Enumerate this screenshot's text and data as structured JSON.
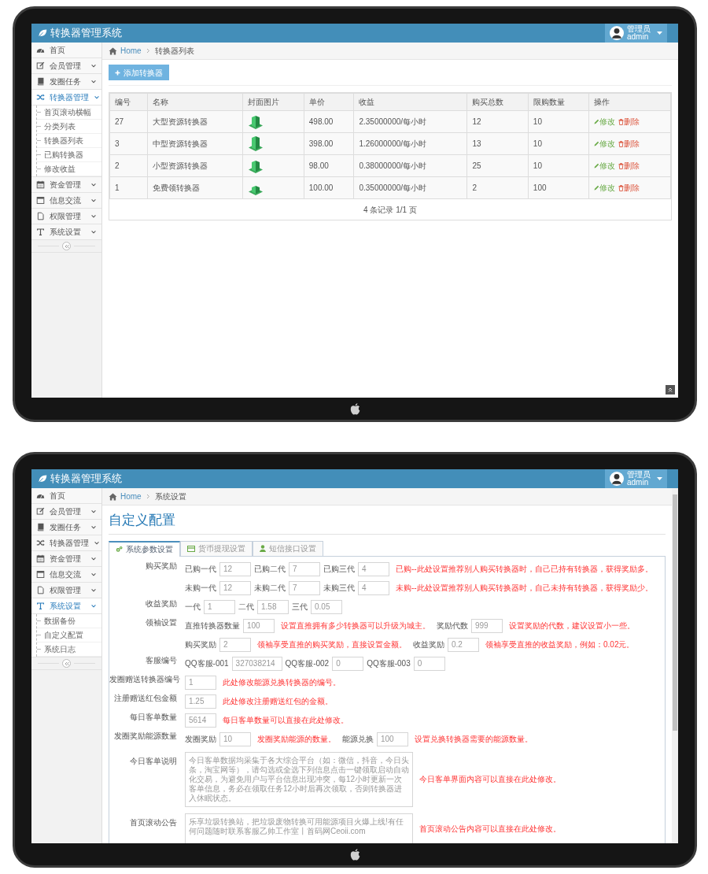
{
  "list_screen": {
    "header": {
      "title": "转换器管理系统",
      "user_role": "管理员",
      "user_name": "admin"
    },
    "sidebar": {
      "items": [
        {
          "label": "首页",
          "collapsible": false,
          "selected": false
        },
        {
          "label": "会员管理",
          "collapsible": true,
          "selected": false
        },
        {
          "label": "发圈任务",
          "collapsible": true,
          "selected": false
        },
        {
          "label": "转换器管理",
          "collapsible": true,
          "selected": true,
          "children": [
            {
              "label": "首页滚动横幅"
            },
            {
              "label": "分类列表"
            },
            {
              "label": "转换器列表"
            },
            {
              "label": "已购转换器"
            },
            {
              "label": "修改收益"
            }
          ]
        },
        {
          "label": "资金管理",
          "collapsible": true,
          "selected": false
        },
        {
          "label": "信息交流",
          "collapsible": true,
          "selected": false
        },
        {
          "label": "权限管理",
          "collapsible": true,
          "selected": false
        },
        {
          "label": "系统设置",
          "collapsible": true,
          "selected": false
        }
      ]
    },
    "breadcrumb": {
      "home": "Home",
      "current": "转换器列表"
    },
    "add_button": "添加转换器",
    "table": {
      "columns": [
        {
          "label": "编号",
          "kind": "text"
        },
        {
          "label": "名称",
          "kind": "text"
        },
        {
          "label": "封面图片",
          "kind": "image"
        },
        {
          "label": "单价",
          "kind": "text"
        },
        {
          "label": "收益",
          "kind": "text"
        },
        {
          "label": "购买总数",
          "kind": "text"
        },
        {
          "label": "限购数量",
          "kind": "text"
        },
        {
          "label": "操作",
          "kind": "actions"
        }
      ],
      "rows": [
        {
          "cells": [
            "27",
            "大型资源转换器",
            "",
            "498.00",
            "2.35000000/每小时",
            "12",
            "10"
          ],
          "actions": [
            {
              "kind": "edit",
              "label": "修改"
            },
            {
              "kind": "delete",
              "label": "删除"
            }
          ]
        },
        {
          "cells": [
            "3",
            "中型资源转换器",
            "",
            "398.00",
            "1.26000000/每小时",
            "13",
            "10"
          ],
          "actions": [
            {
              "kind": "edit",
              "label": "修改"
            },
            {
              "kind": "delete",
              "label": "删除"
            }
          ]
        },
        {
          "cells": [
            "2",
            "小型资源转换器",
            "",
            "98.00",
            "0.38000000/每小时",
            "25",
            "10"
          ],
          "actions": [
            {
              "kind": "edit",
              "label": "修改"
            },
            {
              "kind": "delete",
              "label": "删除"
            }
          ]
        },
        {
          "cells": [
            "1",
            "免费领转换器",
            "",
            "100.00",
            "0.35000000/每小时",
            "2",
            "100"
          ],
          "actions": [
            {
              "kind": "edit",
              "label": "修改"
            },
            {
              "kind": "delete",
              "label": "删除"
            }
          ]
        }
      ],
      "footer": "4 条记录 1/1 页"
    }
  },
  "config_screen": {
    "header": {
      "title": "转换器管理系统",
      "user_role": "管理员",
      "user_name": "admin"
    },
    "sidebar": {
      "items": [
        {
          "label": "首页",
          "collapsible": false,
          "selected": false
        },
        {
          "label": "会员管理",
          "collapsible": true,
          "selected": false
        },
        {
          "label": "发圈任务",
          "collapsible": true,
          "selected": false
        },
        {
          "label": "转换器管理",
          "collapsible": true,
          "selected": false
        },
        {
          "label": "资金管理",
          "collapsible": true,
          "selected": false
        },
        {
          "label": "信息交流",
          "collapsible": true,
          "selected": false
        },
        {
          "label": "权限管理",
          "collapsible": true,
          "selected": false
        },
        {
          "label": "系统设置",
          "collapsible": true,
          "selected": true,
          "children": [
            {
              "label": "数据备份"
            },
            {
              "label": "自定义配置"
            },
            {
              "label": "系统日志"
            }
          ]
        }
      ]
    },
    "breadcrumb": {
      "home": "Home",
      "current": "系统设置"
    },
    "page_title": "自定义配置",
    "tabs": [
      {
        "label": "系统参数设置",
        "selected": true
      },
      {
        "label": "货币提现设置",
        "selected": false
      },
      {
        "label": "短信接口设置",
        "selected": false
      }
    ],
    "form": {
      "rows": [
        {
          "kind": "inputs",
          "label": "购买奖励",
          "items": [
            {
              "prefix": "已购一代",
              "value": "12"
            },
            {
              "prefix": "已购二代",
              "value": "7"
            },
            {
              "prefix": "已购三代",
              "value": "4",
              "note": "已购--此处设置推荐别人购买转换器时，自己已持有转换器，获得奖励多。"
            }
          ]
        },
        {
          "kind": "inputs",
          "items": [
            {
              "prefix": "未购一代",
              "value": "12"
            },
            {
              "prefix": "未购二代",
              "value": "7"
            },
            {
              "prefix": "未购三代",
              "value": "4",
              "note": "未购--此处设置推荐别人购买转换器时，自己未持有转换器，获得奖励少。"
            }
          ]
        },
        {
          "kind": "inputs",
          "label": "收益奖励",
          "items": [
            {
              "prefix": "一代",
              "value": "1"
            },
            {
              "prefix": "二代",
              "value": "1.58"
            },
            {
              "prefix": "三代",
              "value": "0.05"
            }
          ]
        },
        {
          "kind": "inputs",
          "label": "领袖设置",
          "items": [
            {
              "prefix": "直推转换器数量",
              "value": "100",
              "note": "设置直推拥有多少转换器可以升级为城主。"
            },
            {
              "prefix": "奖励代数",
              "value": "999",
              "note": "设置奖励的代数，建议设置小一些。"
            }
          ]
        },
        {
          "kind": "inputs",
          "items": [
            {
              "prefix": "购买奖励",
              "value": "2",
              "note": "领袖享受直推的购买奖励，直接设置金额。"
            },
            {
              "prefix": "收益奖励",
              "value": "0.2",
              "note": "领袖享受直推的收益奖励，例如：0.02元。"
            }
          ]
        },
        {
          "kind": "inputs",
          "label": "客服编号",
          "items": [
            {
              "prefix": "QQ客服-001",
              "value": "327038214"
            },
            {
              "prefix": "QQ客服-002",
              "value": "0"
            },
            {
              "prefix": "QQ客服-003",
              "value": "0"
            }
          ]
        },
        {
          "kind": "inputs",
          "label": "发圈赠送转换器编号",
          "items": [
            {
              "value": "1",
              "note": "此处修改能源兑换转换器的编号。"
            }
          ]
        },
        {
          "kind": "inputs",
          "label": "注册赠送红包金额",
          "items": [
            {
              "value": "1.25",
              "note": "此处修改注册赠送红包的金额。"
            }
          ]
        },
        {
          "kind": "inputs",
          "label": "每日客单数量",
          "items": [
            {
              "value": "5614",
              "note": "每日客单数量可以直接在此处修改。"
            }
          ]
        },
        {
          "kind": "inputs",
          "label": "发圈奖励能源数量",
          "items": [
            {
              "prefix": "发圈奖励",
              "value": "10",
              "note": "发圈奖励能源的数量。"
            },
            {
              "prefix": "能源兑换",
              "value": "100",
              "note": "设置兑换转换器需要的能源数量。"
            }
          ]
        },
        {
          "kind": "textarea",
          "label": "今日客单说明",
          "value": "今日客单数据均采集于各大综合平台（如：微信，抖音，今日头条，淘宝网等），请勾选或全选下列信息点击一键领取启动自动化交易，为避免用户与平台信息出现冲突，每12小时更新一次客单信息，务必在领取任务12小时后再次领取，否则转换器进入休眠状态。",
          "note": "今日客单界面内容可以直接在此处修改。"
        },
        {
          "kind": "textarea",
          "label": "首页滚动公告",
          "value": "乐享垃圾转换站，把垃圾废物转换可用能源项目火爆上线!有任何问题随时联系客服乙帅工作室丨首码网Ceoii.com",
          "note": "首页滚动公告内容可以直接在此处修改。"
        }
      ]
    }
  }
}
